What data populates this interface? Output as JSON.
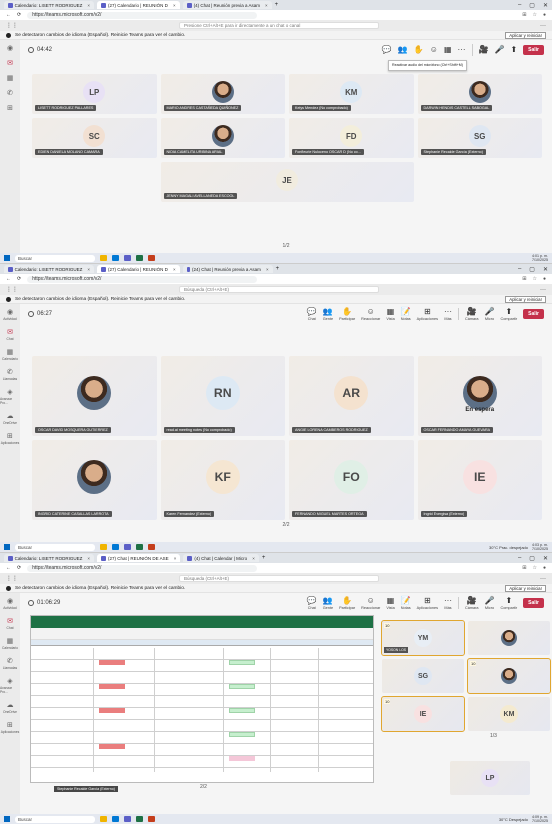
{
  "screen1": {
    "tabs": [
      {
        "label": "Calendario: LISETT RODRIGUEZ",
        "active": false
      },
      {
        "label": "(27) Calendario | REUNIÓN D",
        "active": true
      },
      {
        "label": "(4) Chat | Reunión previa a Asam",
        "active": false
      }
    ],
    "url": "https://teams.microsoft.com/v2/",
    "search_placeholder": "Presione Ctrl+Alt+E para ir directamente a un chat o canal",
    "notice": "Se detectaron cambios de idioma (Español). Reinicie Teams para ver el cambio.",
    "apply_button": "Aplicar y reiniciar",
    "timer": "04:42",
    "tooltip": "Reactivar audio del micrófono (Ctrl+Shift+M)",
    "participants": [
      {
        "initials": "LP",
        "name": "LISETT RODRIGUEZ PALLARES",
        "color": "#e8e1f5",
        "photo": false
      },
      {
        "initials": "",
        "name": "MARIO ANDRES CASTAÑEDA QUIÑONEZ",
        "color": "",
        "photo": true
      },
      {
        "initials": "KM",
        "name": "Kelys Mendez (No comprobado)",
        "color": "#dde9f4",
        "photo": false
      },
      {
        "initials": "",
        "name": "DARWIN HENDIS CASTELL SABOGAL",
        "color": "",
        "photo": true
      },
      {
        "initials": "SC",
        "name": "EDIEN DANIELA MOLANO CAMARA",
        "color": "#f2e0d2",
        "photo": false
      },
      {
        "initials": "",
        "name": "NIDIA CAMELITA URIBINA ARIAL",
        "color": "",
        "photo": true
      },
      {
        "initials": "FD",
        "name": "Fonfleurie Nuloceno OSCAR D (No co...",
        "color": "#f3eedb",
        "photo": false
      },
      {
        "initials": "SG",
        "name": "Stephanie Recalde García (Externo)",
        "color": "#dfe7f2",
        "photo": false
      },
      {
        "initials": "JE",
        "name": "JENNY MAGALI AVELLANEDA ESCOOL",
        "color": "#f1ecdf",
        "photo": false
      }
    ],
    "pager": "1/2",
    "taskbar_search": "Buscar",
    "clock_time": "4:01 p. m.",
    "clock_date": "7/10/2025"
  },
  "screen2": {
    "tabs": [
      {
        "label": "Calendario: LISETT RODRIGUEZ",
        "active": false
      },
      {
        "label": "(27) Calendario | REUNIÓN D",
        "active": true
      },
      {
        "label": "(24) Chat | Reunión previa a Asam",
        "active": false
      }
    ],
    "url": "https://teams.microsoft.com/v2/",
    "search_placeholder": "Búsqueda (Ctrl+Alt+E)",
    "notice": "Se detectaron cambios de idioma (Español). Reinicie Teams para ver el cambio.",
    "apply_button": "Aplicar y reiniciar",
    "timer": "06:27",
    "controls": [
      "Chat",
      "Gente",
      "Participar",
      "Reaccionar",
      "Vista",
      "Notas",
      "Aplicaciones",
      "Más",
      "Cámara",
      "Micro",
      "Compartir"
    ],
    "leave_label": "Salir",
    "rail": [
      "Actividad",
      "Chat",
      "Calendario",
      "Llamadas",
      "Avanzar Pro...",
      "OneDrive",
      "Aplicaciones"
    ],
    "participants": [
      {
        "initials": "",
        "name": "OSCAR DAVID MOSQUERA GUTIERREZ",
        "color": "",
        "photo": true,
        "hold": ""
      },
      {
        "initials": "RN",
        "name": "read.ai meeting notes (No comprobado)",
        "color": "#dde9f4",
        "photo": false,
        "hold": ""
      },
      {
        "initials": "AR",
        "name": "ANGIE LORENA CAMBEROS RODRIGUEZ",
        "color": "#f4e2cf",
        "photo": false,
        "hold": ""
      },
      {
        "initials": "",
        "name": "OSCAR FERNANDO AMAYA GUEVARA",
        "color": "",
        "photo": true,
        "hold": "En espera"
      },
      {
        "initials": "",
        "name": "INGRID CATERINE CASALLAS LARROTA",
        "color": "",
        "photo": true,
        "hold": ""
      },
      {
        "initials": "KF",
        "name": "Karen Fernandez (Externo)",
        "color": "#f5e6d2",
        "photo": false,
        "hold": ""
      },
      {
        "initials": "FO",
        "name": "FERNANDO MIGUEL MARTES ORTEGA",
        "color": "#e0efe6",
        "photo": false,
        "hold": ""
      },
      {
        "initials": "IE",
        "name": "Ingrid Evergisa (Externo)",
        "color": "#f8e1e1",
        "photo": false,
        "hold": ""
      }
    ],
    "pager": "2/2",
    "taskbar_search": "Buscar",
    "weather": "30°C Prac. despejado",
    "clock_time": "4:03 p. m.",
    "clock_date": "7/10/2025"
  },
  "screen3": {
    "tabs": [
      {
        "label": "Calendario: LISETT RODRIGUEZ",
        "active": false
      },
      {
        "label": "(27) Chat | REUNIÓN DE ASE",
        "active": true
      },
      {
        "label": "(4) Chat | Calendar | Micro",
        "active": false
      }
    ],
    "url": "https://teams.microsoft.com/v2/",
    "search_placeholder": "Búsqueda (Ctrl+Alt+E)",
    "notice": "Se detectaron cambios de idioma (Español). Reinicie Teams para ver el cambio.",
    "apply_button": "Aplicar y reiniciar",
    "timer": "01:06:29",
    "presenter": "Stephanie Recalde García (Externo)",
    "gallery": [
      {
        "num": "10",
        "initials": "YM",
        "name": "YOSON LOS",
        "color": "#e8eef5",
        "photo": false,
        "selected": true
      },
      {
        "num": "",
        "initials": "",
        "name": "",
        "color": "",
        "photo": true,
        "selected": false
      },
      {
        "num": "",
        "initials": "SG",
        "name": "",
        "color": "#dfe7f2",
        "photo": false,
        "selected": false
      },
      {
        "num": "10",
        "initials": "",
        "name": "",
        "color": "",
        "photo": true,
        "selected": true
      },
      {
        "num": "10",
        "initials": "IE",
        "name": "",
        "color": "#f8e1e1",
        "photo": false,
        "selected": true
      },
      {
        "num": "",
        "initials": "KM",
        "name": "",
        "color": "#f4ead0",
        "photo": false,
        "selected": false
      }
    ],
    "gallery_pager": "1/3",
    "self_initials": "LP",
    "pager": "2/2",
    "taskbar_search": "Buscar",
    "weather": "30°C Despejado",
    "clock_time": "4:09 p. m.",
    "clock_date": "7/10/2025"
  }
}
